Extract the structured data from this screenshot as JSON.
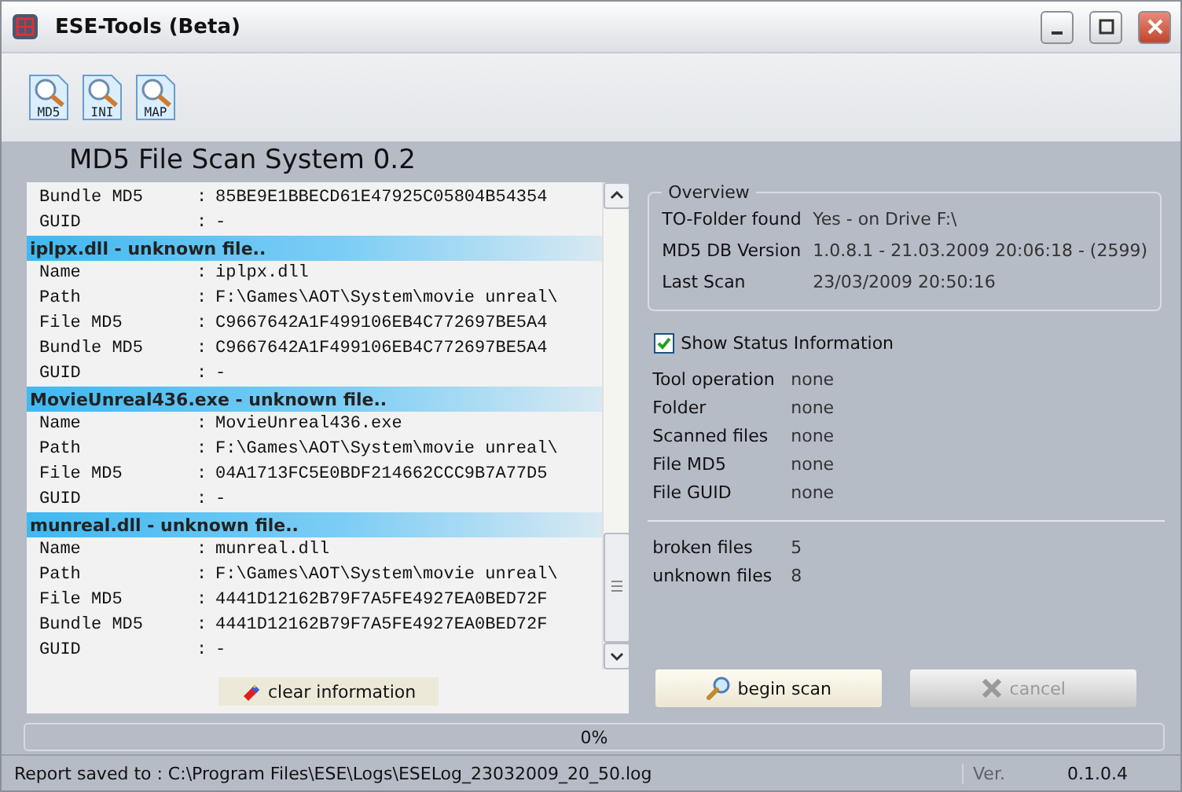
{
  "window": {
    "title": "ESE-Tools (Beta)"
  },
  "toolbar": [
    {
      "label": "MD5"
    },
    {
      "label": "INI"
    },
    {
      "label": "MAP"
    }
  ],
  "heading": "MD5 File Scan System 0.2",
  "log": [
    {
      "rows": [
        {
          "key": "Bundle MD5",
          "sep": ":",
          "value": "85BE9E1BBECD61E47925C05804B54354"
        },
        {
          "key": "GUID",
          "sep": ":",
          "value": "-"
        }
      ]
    },
    {
      "header": "iplpx.dll - unknown file..",
      "rows": [
        {
          "key": "Name",
          "sep": ":",
          "value": "iplpx.dll"
        },
        {
          "key": "Path",
          "sep": ":",
          "value": "F:\\Games\\AOT\\System\\movie unreal\\"
        },
        {
          "key": "File MD5",
          "sep": ":",
          "value": "C9667642A1F499106EB4C772697BE5A4"
        },
        {
          "key": "Bundle MD5",
          "sep": ":",
          "value": "C9667642A1F499106EB4C772697BE5A4"
        },
        {
          "key": "GUID",
          "sep": ":",
          "value": "-"
        }
      ]
    },
    {
      "header": "MovieUnreal436.exe - unknown file..",
      "rows": [
        {
          "key": "Name",
          "sep": ":",
          "value": "MovieUnreal436.exe"
        },
        {
          "key": "Path",
          "sep": ":",
          "value": "F:\\Games\\AOT\\System\\movie unreal\\"
        },
        {
          "key": "File MD5",
          "sep": ":",
          "value": "04A1713FC5E0BDF214662CCC9B7A77D5"
        },
        {
          "key": "GUID",
          "sep": ":",
          "value": "-"
        }
      ]
    },
    {
      "header": "munreal.dll - unknown file..",
      "rows": [
        {
          "key": "Name",
          "sep": ":",
          "value": "munreal.dll"
        },
        {
          "key": "Path",
          "sep": ":",
          "value": "F:\\Games\\AOT\\System\\movie unreal\\"
        },
        {
          "key": "File MD5",
          "sep": ":",
          "value": "4441D12162B79F7A5FE4927EA0BED72F"
        },
        {
          "key": "Bundle MD5",
          "sep": ":",
          "value": "4441D12162B79F7A5FE4927EA0BED72F"
        },
        {
          "key": "GUID",
          "sep": ":",
          "value": "-"
        }
      ]
    }
  ],
  "clear_button": {
    "label": "clear information"
  },
  "overview": {
    "title": "Overview",
    "rows": [
      {
        "label": "TO-Folder found",
        "value": "Yes - on Drive F:\\"
      },
      {
        "label": "MD5 DB Version",
        "value": "1.0.8.1 - 21.03.2009 20:06:18 - (2599)"
      },
      {
        "label": "Last Scan",
        "value": "23/03/2009 20:50:16"
      }
    ]
  },
  "show_status": {
    "label": "Show Status Information",
    "checked": true
  },
  "status": [
    {
      "label": "Tool operation",
      "value": "none"
    },
    {
      "label": "Folder",
      "value": "none"
    },
    {
      "label": "Scanned files",
      "value": "none"
    },
    {
      "label": "File MD5",
      "value": "none"
    },
    {
      "label": "File GUID",
      "value": "none"
    }
  ],
  "counts": [
    {
      "label": "broken files",
      "value": "5"
    },
    {
      "label": "unknown files",
      "value": "8"
    }
  ],
  "buttons": [
    {
      "kind": "scan",
      "label": "begin scan",
      "disabled": false
    },
    {
      "kind": "cancel",
      "label": "cancel",
      "disabled": true
    }
  ],
  "progress": {
    "level": 0,
    "text": "0%"
  },
  "status_bar": {
    "report": "Report saved to : C:\\Program Files\\ESE\\Logs\\ESELog_23032009_20_50.log",
    "version_label": "Ver.",
    "version": "0.1.0.4"
  }
}
